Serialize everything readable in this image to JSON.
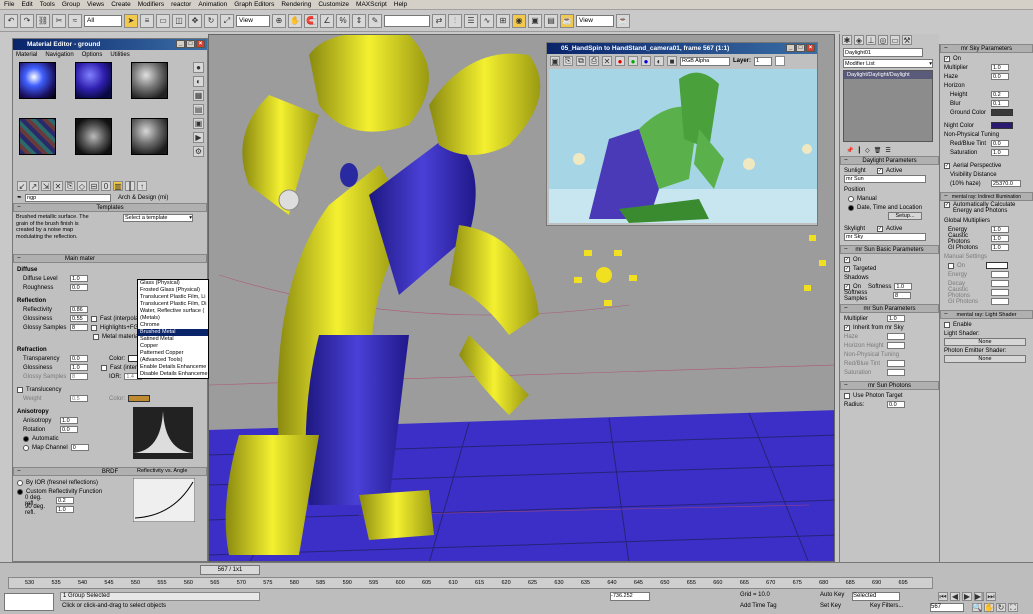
{
  "menubar": [
    "File",
    "Edit",
    "Tools",
    "Group",
    "Views",
    "Create",
    "Modifiers",
    "reactor",
    "Animation",
    "Graph Editors",
    "Rendering",
    "Customize",
    "MAXScript",
    "Help"
  ],
  "toolbar": {
    "selection_filter": "All",
    "view_dropdown": "View",
    "view_dropdown2": "View"
  },
  "material_editor": {
    "title": "Material Editor - ground",
    "menus": [
      "Material",
      "Navigation",
      "Options",
      "Utilities"
    ],
    "material_name": "ngp",
    "material_type": "Arch & Design (mi)",
    "templates_rollout": "Templates",
    "template_desc": "Brushed metallic surface. The grain of the brush finish is created by a noise map modulating the reflection.",
    "template_select": "Select a template",
    "template_options": [
      "Glass (Physical)",
      "Frosted Glass (Physical)",
      "Translucent Plastic Film, Li",
      "Translucent Plastic Film, Di",
      "Water, Reflective surface (",
      "(Metals)",
      "Chrome",
      "Brushed Metal",
      "Satined Metal",
      "Copper",
      "Patterned Copper",
      "(Advanced Tools)",
      "Enable Details Enhanceme",
      "Disable Details Enhanceme"
    ],
    "template_selected": "Brushed Metal",
    "main_rollout": "Main mater",
    "diffuse": {
      "label": "Diffuse",
      "level_label": "Diffuse Level",
      "level": "1.0",
      "rough_label": "Roughness",
      "rough": "0.0"
    },
    "reflection": {
      "label": "Reflection",
      "reflectivity_label": "Reflectivity",
      "reflectivity": "0.86",
      "gloss_label": "Glossiness",
      "gloss": "0.55",
      "samples_label": "Glossy Samples",
      "samples": "8",
      "fast_interp": "Fast (interpolate)",
      "highlights": "Highlights+FG only",
      "metal": "Metal material"
    },
    "refraction": {
      "label": "Refraction",
      "transparency_label": "Transparency",
      "transparency": "0.0",
      "gloss_label": "Glossiness",
      "gloss": "1.0",
      "samples_label": "Glossy Samples",
      "samples": "8",
      "color_label": "Color:",
      "fast_interp": "Fast (interpolate)",
      "ior_label": "IOR:",
      "ior": "1.4"
    },
    "translucency": {
      "label": "Translucency",
      "weight_label": "Weight",
      "weight": "0.5",
      "color_label": "Color:"
    },
    "anisotropy": {
      "label": "Anisotropy",
      "aniso_label": "Anisotropy",
      "aniso": "1.0",
      "rotation_label": "Rotation",
      "rotation": "0.0",
      "automatic": "Automatic",
      "map_channel": "Map Channel",
      "map_channel_val": "0"
    },
    "brdf": {
      "rollout": "BRDF",
      "by_ior": "By IOR (fresnel reflections)",
      "custom": "Custom Reflectivity Function",
      "graph_label": "Reflectivity vs. Angle",
      "deg0_label": "0 deg. refl.",
      "deg0": "0.2",
      "deg90_label": "90 deg. refl.",
      "deg90": "1.0"
    }
  },
  "render_window": {
    "title": "05_HandSpin to HandStand_camera01, frame 567 (1:1)",
    "channel": "RGB Alpha",
    "layer_label": "Layer:",
    "layer_val": "1"
  },
  "command_panel": {
    "object_name": "Daylight01",
    "modifier_list": "Modifier List",
    "stack_item": "Daylight/Daylight/Daylight",
    "daylight_rollout": "Daylight Parameters",
    "sunlight_label": "Sunlight",
    "active": "Active",
    "sun_value": "mr Sun",
    "position_label": "Position",
    "manual": "Manual",
    "date_time": "Date, Time and Location",
    "setup": "Setup...",
    "skylight_label": "Skylight",
    "sky_value": "mr Sky",
    "shadows_rollout": "mr Sun Basic Parameters",
    "on": "On",
    "targeted": "Targeted",
    "shadows_label": "Shadows",
    "softness_label": "Softness",
    "softness": "1.0",
    "soft_samples_label": "Softness Samples",
    "soft_samples": "8",
    "sun_params_rollout": "mr Sun Parameters",
    "multiplier_label": "Multiplier",
    "multiplier": "1.0",
    "inherit": "Inherit from mr Sky",
    "haze_label": "Haze",
    "horizon_label": "Horizon Height",
    "nonphys_label": "Non-Physical Tuning",
    "redblue_label": "Red/Blue Tint",
    "saturation_label": "Saturation",
    "photons_rollout": "mr Sun Photons",
    "use_photon": "Use Photon Target",
    "radius_label": "Radius:",
    "radius": "0.0"
  },
  "sky_panel": {
    "rollout": "mr Sky Parameters",
    "on": "On",
    "multiplier_label": "Multiplier",
    "multiplier": "1.0",
    "haze_label": "Haze",
    "haze": "0.0",
    "horizon_label": "Horizon",
    "height_label": "Height",
    "height": "0.2",
    "blur_label": "Blur",
    "blur": "0.1",
    "ground_label": "Ground Color",
    "night_label": "Night Color",
    "nonphys_label": "Non-Physical Tuning",
    "redblue_label": "Red/Blue Tint",
    "redblue": "0.0",
    "sat_label": "Saturation",
    "sat": "1.0",
    "aerial": "Aerial Perspective",
    "visibility_label": "Visibility Distance",
    "visibility_sub": "(10% haze)",
    "visibility": "25370.0",
    "gi_rollout": "mental ray: Indirect Illumination",
    "auto_calc": "Automatically Calculate Energy and Photons",
    "global_mult": "Global Multipliers",
    "energy_label": "Energy",
    "energy": "1.0",
    "caustic_label": "Caustic Photons",
    "caustic": "1.0",
    "gi_label": "GI Photons",
    "gi": "1.0",
    "manual_label": "Manual Settings",
    "m_on": "On",
    "m_energy": "Energy",
    "m_decay": "Decay",
    "m_caustic": "Caustic Photons",
    "m_gi": "GI Photons",
    "shader_rollout": "mental ray: Light Shader",
    "enable": "Enable",
    "light_shader": "Light Shader:",
    "none1": "None",
    "photon_shader": "Photon Emitter Shader:",
    "none2": "None"
  },
  "timeline": {
    "frame_display": "567 / 1x1",
    "ticks": [
      "530",
      "535",
      "540",
      "545",
      "550",
      "555",
      "560",
      "565",
      "570",
      "575",
      "580",
      "585",
      "590",
      "595",
      "600",
      "605",
      "610",
      "615",
      "620",
      "625",
      "630",
      "635",
      "640",
      "645",
      "650",
      "655",
      "660",
      "665",
      "670",
      "675",
      "680",
      "685",
      "690",
      "695"
    ],
    "status": "1 Group Selected",
    "prompt": "Click or click-and-drag to select objects",
    "x_val": "-736.252",
    "grid": "Grid = 10.0",
    "auto_key": "Auto Key",
    "selected": "Selected",
    "set_key": "Set Key",
    "key_filters": "Key Filters...",
    "add_time_tag": "Add Time Tag",
    "frame": "567"
  },
  "colors": {
    "viewport_bg": "#9c9c9c",
    "figure_yellow": "#e8e41a",
    "figure_blue": "#3a2fb0",
    "floor": "#3b2fc8",
    "accent": "#0a246a"
  }
}
